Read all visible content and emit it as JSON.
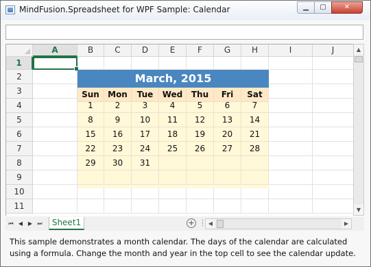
{
  "window": {
    "title": "MindFusion.Spreadsheet for WPF Sample: Calendar",
    "min_glyph": "▁",
    "max_glyph": "▢",
    "close_glyph": "✕"
  },
  "formula_bar": {
    "value": ""
  },
  "columns": [
    "A",
    "B",
    "C",
    "D",
    "E",
    "F",
    "G",
    "H",
    "I",
    "J"
  ],
  "rows": [
    "1",
    "2",
    "3",
    "4",
    "5",
    "6",
    "7",
    "8",
    "9",
    "10",
    "11"
  ],
  "active_cell": "A1",
  "calendar": {
    "title": "March, 2015",
    "day_names": [
      "Sun",
      "Mon",
      "Tue",
      "Wed",
      "Thu",
      "Fri",
      "Sat"
    ],
    "weeks": [
      [
        "1",
        "2",
        "3",
        "4",
        "5",
        "6",
        "7"
      ],
      [
        "8",
        "9",
        "10",
        "11",
        "12",
        "13",
        "14"
      ],
      [
        "15",
        "16",
        "17",
        "18",
        "19",
        "20",
        "21"
      ],
      [
        "22",
        "23",
        "24",
        "25",
        "26",
        "27",
        "28"
      ],
      [
        "29",
        "30",
        "31",
        "",
        "",
        "",
        ""
      ],
      [
        "",
        "",
        "",
        "",
        "",
        "",
        ""
      ]
    ],
    "header_color": "#4a86c0",
    "daynames_color": "#ffe8c6",
    "body_color": "#fff8d9"
  },
  "tabs": {
    "nav": [
      "⏮",
      "◀",
      "▶",
      "⏭"
    ],
    "sheets": [
      "Sheet1"
    ],
    "add_glyph": "+"
  },
  "scroll": {
    "up": "▲",
    "down": "▼",
    "left": "◀",
    "right": "▶"
  },
  "description": "This sample demonstrates a month calendar. The days of the calendar are calculated using a formula. Change the month and year in the top cell to see the calendar update."
}
